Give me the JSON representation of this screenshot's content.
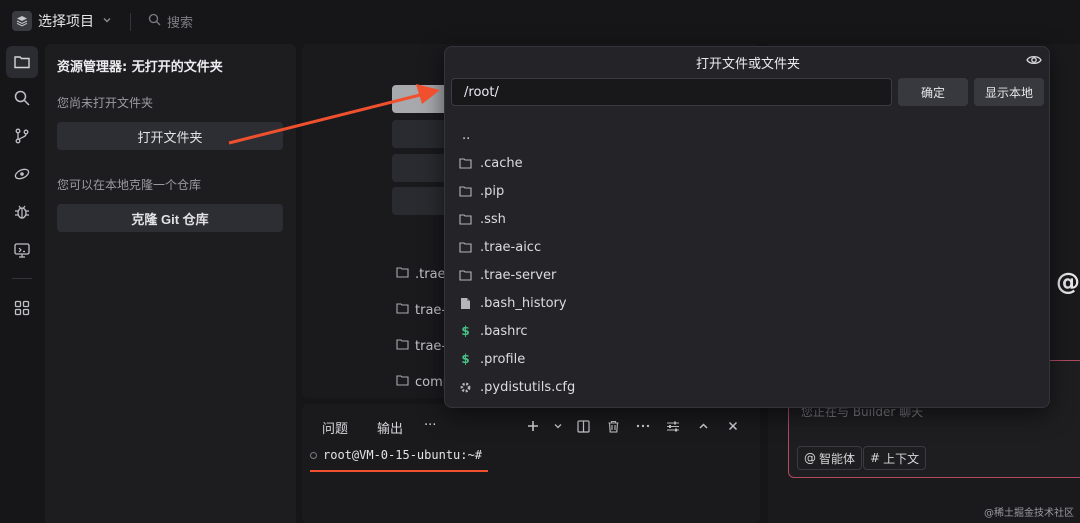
{
  "topbar": {
    "project_label": "选择项目",
    "search_label": "搜索"
  },
  "activity_icons": [
    "explorer-icon",
    "search-icon",
    "source-control-icon",
    "remote-icon",
    "debug-icon",
    "remote-explorer-icon",
    "extensions-icon"
  ],
  "explorer": {
    "title": "资源管理器: 无打开的文件夹",
    "no_folder_text": "您尚未打开文件夹",
    "open_folder_button": "打开文件夹",
    "clone_text": "您可以在本地克隆一个仓库",
    "clone_button": "克隆 Git 仓库"
  },
  "center": {
    "recent": [
      ".trae",
      "trae-",
      "trae-",
      "comp"
    ]
  },
  "panel": {
    "tabs": [
      "问题",
      "输出",
      "···"
    ],
    "terminal_prompt": "root@VM-0-15-ubuntu:~#"
  },
  "chat": {
    "placeholder": "您正在与 Builder 聊天",
    "chip_agent": "智能体",
    "chip_context": "上下文",
    "at_symbol": "@"
  },
  "dialog": {
    "title": "打开文件或文件夹",
    "path_value": "/root/",
    "confirm_button": "确定",
    "show_local_button": "显示本地",
    "items": [
      {
        "name": "..",
        "icon": "none"
      },
      {
        "name": ".cache",
        "icon": "folder-icon"
      },
      {
        "name": ".pip",
        "icon": "folder-icon"
      },
      {
        "name": ".ssh",
        "icon": "folder-icon"
      },
      {
        "name": ".trae-aicc",
        "icon": "folder-icon"
      },
      {
        "name": ".trae-server",
        "icon": "folder-icon"
      },
      {
        "name": ".bash_history",
        "icon": "file-icon"
      },
      {
        "name": ".bashrc",
        "icon": "shell-icon"
      },
      {
        "name": ".profile",
        "icon": "shell-icon"
      },
      {
        "name": ".pydistutils.cfg",
        "icon": "gear-icon"
      }
    ]
  },
  "watermark": "@稀土掘金技术社区",
  "colors": {
    "accent_arrow": "#f0502d",
    "shell_green": "#48c286",
    "chat_border": "#b24a60"
  }
}
